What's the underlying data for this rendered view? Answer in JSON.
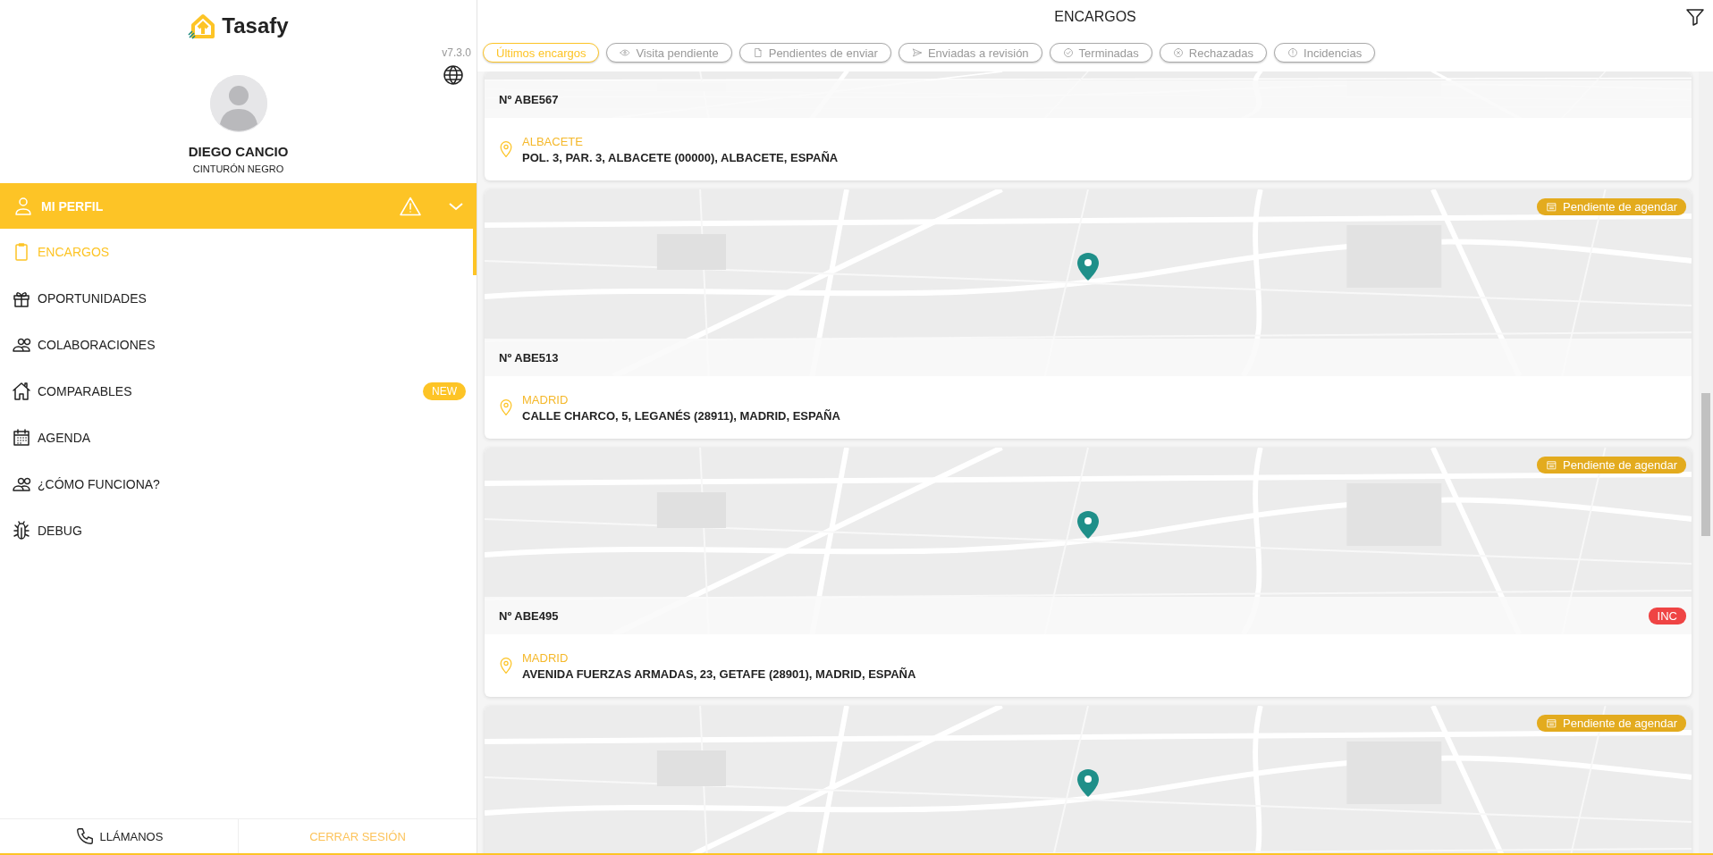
{
  "app": {
    "logo_text": "Tasafy",
    "version": "v7.3.0"
  },
  "user": {
    "name": "DIEGO CANCIO",
    "rank": "CINTURÓN NEGRO"
  },
  "profile_menu": {
    "label": "MI PERFIL"
  },
  "nav_items": [
    {
      "label": "ENCARGOS",
      "selected": true
    },
    {
      "label": "OPORTUNIDADES",
      "selected": false
    },
    {
      "label": "COLABORACIONES",
      "selected": false
    },
    {
      "label": "COMPARABLES",
      "selected": false,
      "badge": "NEW"
    },
    {
      "label": "AGENDA",
      "selected": false
    },
    {
      "label": "¿CÓMO FUNCIONA?",
      "selected": false
    },
    {
      "label": "DEBUG",
      "selected": false
    }
  ],
  "footer": {
    "call_label": "LLÁMANOS",
    "logout_label": "CERRAR SESIÓN"
  },
  "page": {
    "title": "ENCARGOS"
  },
  "filter_tabs": [
    {
      "label": "Últimos encargos",
      "selected": true
    },
    {
      "label": "Visita pendiente",
      "selected": false
    },
    {
      "label": "Pendientes de enviar",
      "selected": false
    },
    {
      "label": "Enviadas a revisión",
      "selected": false
    },
    {
      "label": "Terminadas",
      "selected": false
    },
    {
      "label": "Rechazadas",
      "selected": false
    },
    {
      "label": "Incidencias",
      "selected": false
    }
  ],
  "orders": [
    {
      "number": "Nº ABE567",
      "province": "ALBACETE",
      "address": "POL. 3, PAR. 3, ALBACETE (00000), ALBACETE, ESPAÑA"
    },
    {
      "number": "Nº ABE513",
      "province": "MADRID",
      "address": "CALLE CHARCO, 5, LEGANÉS (28911), MADRID, ESPAÑA",
      "status_badge": "Pendiente de agendar"
    },
    {
      "number": "Nº ABE495",
      "province": "MADRID",
      "address": "AVENIDA FUERZAS ARMADAS, 23, GETAFE (28901), MADRID, ESPAÑA",
      "status_badge": "Pendiente de agendar",
      "incidence_badge": "INC"
    },
    {
      "status_badge": "Pendiente de agendar"
    }
  ]
}
